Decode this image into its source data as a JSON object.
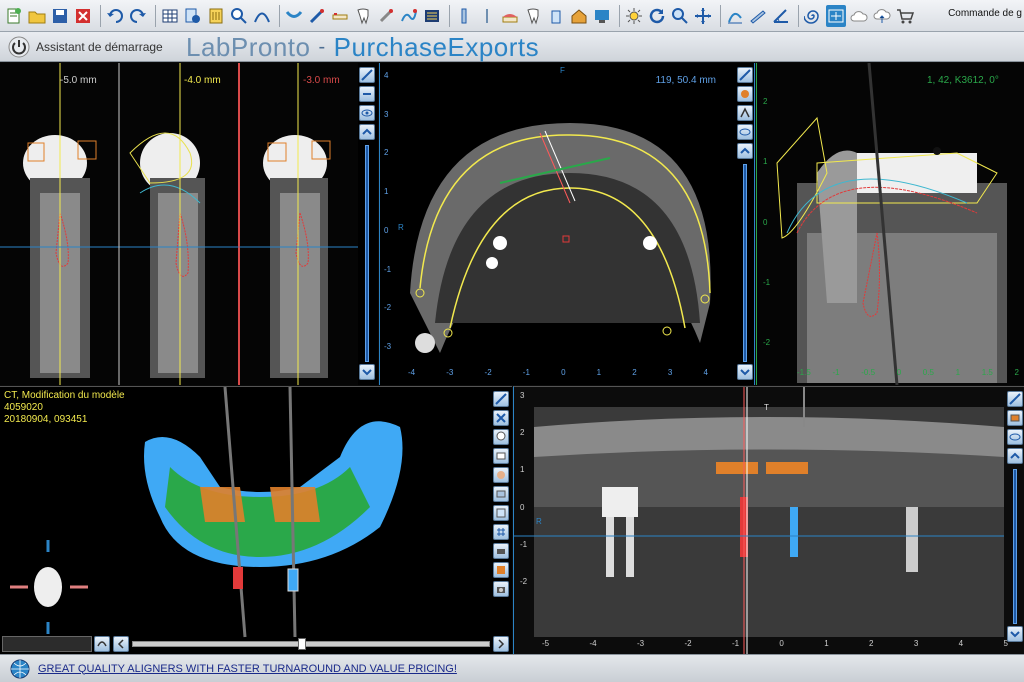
{
  "toolbar": {
    "icons": [
      "new-case-icon",
      "open-folder-icon",
      "save-icon",
      "close-icon",
      "undo-icon",
      "redo-icon",
      "layout-grid-icon",
      "import-icon",
      "export-icon",
      "zoom-icon",
      "curve-icon",
      "arch-curve-icon",
      "implant-icon",
      "tooth-icon",
      "bone-icon",
      "nerve-icon",
      "settings-icon",
      "brightness-icon",
      "refresh-icon",
      "magnify-icon",
      "pan-icon",
      "histogram-icon",
      "ruler-icon",
      "angle-icon",
      "spiral-icon",
      "screen-icon",
      "cloud-icon",
      "cloud-upload-icon",
      "cart-icon"
    ],
    "order_label": "Commande de g"
  },
  "header": {
    "assistant_label": "Assistant de démarrage",
    "brand_lab": "LabPronto",
    "brand_sep": "-",
    "brand_purchase": "PurchaseExports"
  },
  "cross_sections": [
    {
      "offset": "-5.0 mm",
      "color": "#cfcfcf"
    },
    {
      "offset": "-4.0 mm",
      "color": "#f2e94e"
    },
    {
      "offset": "-3.0 mm",
      "color": "#d94a4a"
    }
  ],
  "axial": {
    "coords": "119, 50.4 mm",
    "label_top": "F",
    "label_left": "R",
    "x_ticks": [
      "-4",
      "-3",
      "-2",
      "-1",
      "0",
      "1",
      "2",
      "3",
      "4"
    ],
    "y_ticks": [
      "4",
      "3",
      "2",
      "1",
      "0",
      "-1",
      "-2",
      "-3"
    ]
  },
  "sagittal": {
    "coords": "1, 42, K3612, 0°",
    "y_ticks": [
      "2",
      "1",
      "0",
      "-1",
      "-2"
    ],
    "x_ticks": [
      "-1.5",
      "-1",
      "-0.5",
      "0",
      "0.5",
      "1",
      "1.5",
      "2"
    ]
  },
  "model3d": {
    "title": "CT, Modification du modèle",
    "patient_id": "4059020",
    "timestamp": "20180904, 093451"
  },
  "panoramic": {
    "label_top": "T",
    "label_left": "R",
    "y_ticks": [
      "3",
      "2",
      "1",
      "0",
      "-1",
      "-2"
    ],
    "x_ticks": [
      "-5",
      "-4",
      "-3",
      "-2",
      "-1",
      "0",
      "1",
      "2",
      "3",
      "4",
      "5"
    ]
  },
  "statusbar": {
    "promo_link": "GREAT QUALITY ALIGNERS WITH FASTER TURNAROUND AND VALUE PRICING!"
  },
  "colors": {
    "accent_blue": "#2b84c6",
    "guide_yellow": "#f2e94e",
    "nerve_red": "#e23a3a",
    "model_cyan": "#3fa9f5",
    "model_green": "#2aa84a",
    "sleeve_orange": "#e0802a"
  }
}
